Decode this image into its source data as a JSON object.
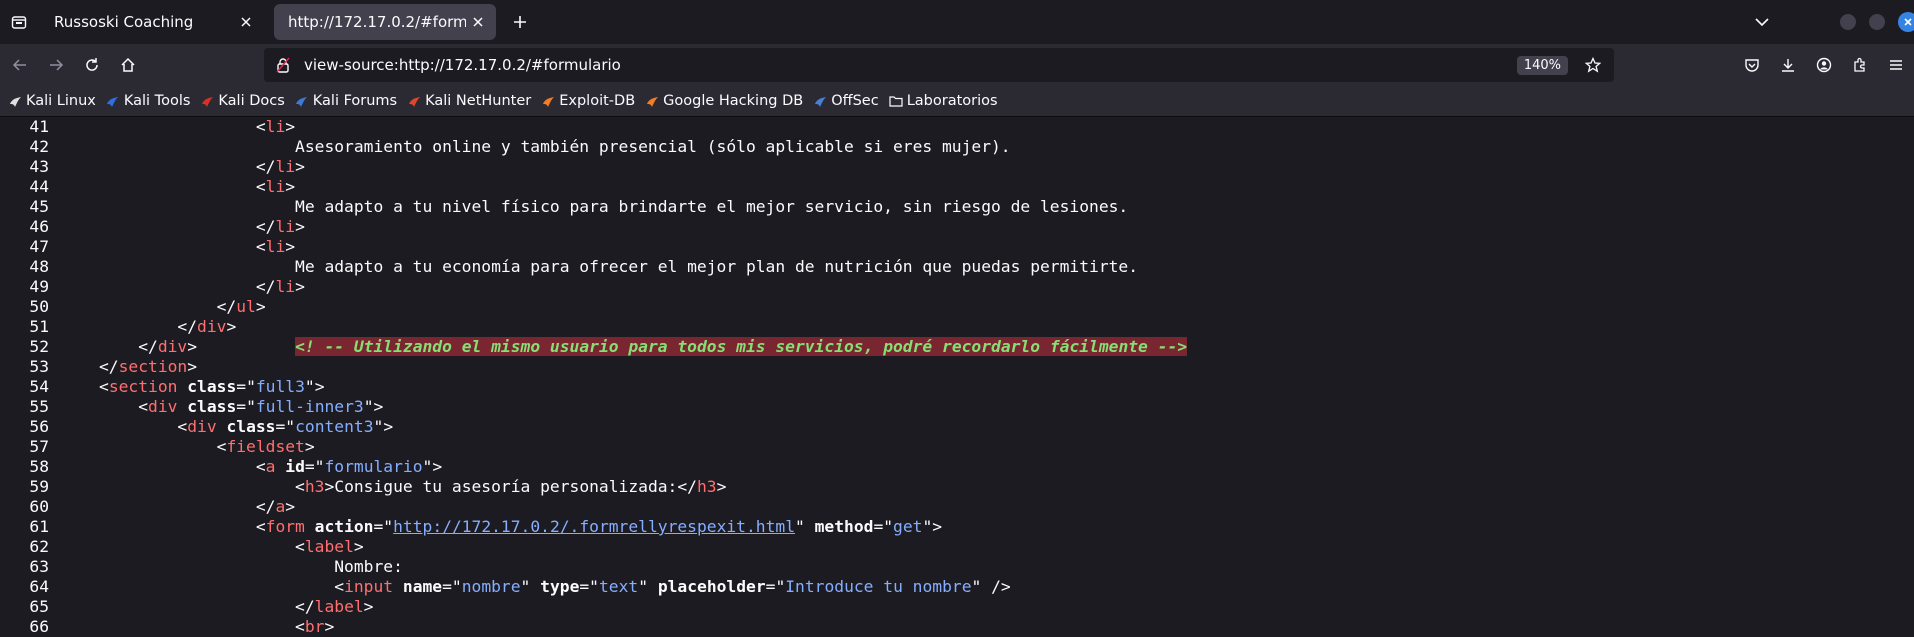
{
  "tabs": [
    {
      "title": "Russoski Coaching",
      "active": false
    },
    {
      "title": "http://172.17.0.2/#formulario",
      "active": true
    }
  ],
  "urlbar": {
    "url": "view-source:http://172.17.0.2/#formulario",
    "zoom": "140%"
  },
  "bookmarks": [
    {
      "label": "Kali Linux",
      "icon": "kali-dragon-icon",
      "color": "#e0e0e0"
    },
    {
      "label": "Kali Tools",
      "icon": "kali-tools-icon",
      "color": "#2f6fe0"
    },
    {
      "label": "Kali Docs",
      "icon": "kali-docs-icon",
      "color": "#d93025"
    },
    {
      "label": "Kali Forums",
      "icon": "kali-forums-icon",
      "color": "#3a7bd5"
    },
    {
      "label": "Kali NetHunter",
      "icon": "kali-nethunter-icon",
      "color": "#e0452d"
    },
    {
      "label": "Exploit-DB",
      "icon": "exploit-db-icon",
      "color": "#f07d2a"
    },
    {
      "label": "Google Hacking DB",
      "icon": "ghdb-icon",
      "color": "#f07d2a"
    },
    {
      "label": "OffSec",
      "icon": "offsec-icon",
      "color": "#4a7fd8"
    },
    {
      "label": "Laboratorios",
      "icon": "folder-icon",
      "color": "#fbfbfe"
    }
  ],
  "colors": {
    "tag": "#ff6f6f",
    "value": "#86aeff",
    "comment": "#86de74",
    "comment_bg": "#7a2630"
  },
  "source_lines": [
    {
      "n": "41",
      "parts": [
        [
          "t",
          "                <"
        ],
        [
          "n",
          "li"
        ],
        [
          "t",
          ">"
        ]
      ]
    },
    {
      "n": "42",
      "parts": [
        [
          "t",
          "                    Asesoramiento online y también presencial (sólo aplicable si eres mujer)."
        ]
      ]
    },
    {
      "n": "43",
      "parts": [
        [
          "t",
          "                </"
        ],
        [
          "n",
          "li"
        ],
        [
          "t",
          ">"
        ]
      ]
    },
    {
      "n": "44",
      "parts": [
        [
          "t",
          "                <"
        ],
        [
          "n",
          "li"
        ],
        [
          "t",
          ">"
        ]
      ]
    },
    {
      "n": "45",
      "parts": [
        [
          "t",
          "                    Me adapto a tu nivel físico para brindarte el mejor servicio, sin riesgo de lesiones."
        ]
      ]
    },
    {
      "n": "46",
      "parts": [
        [
          "t",
          "                </"
        ],
        [
          "n",
          "li"
        ],
        [
          "t",
          ">"
        ]
      ]
    },
    {
      "n": "47",
      "parts": [
        [
          "t",
          "                <"
        ],
        [
          "n",
          "li"
        ],
        [
          "t",
          ">"
        ]
      ]
    },
    {
      "n": "48",
      "parts": [
        [
          "t",
          "                    Me adapto a tu economía para ofrecer el mejor plan de nutrición que puedas permitirte."
        ]
      ]
    },
    {
      "n": "49",
      "parts": [
        [
          "t",
          "                </"
        ],
        [
          "n",
          "li"
        ],
        [
          "t",
          ">"
        ]
      ]
    },
    {
      "n": "50",
      "parts": [
        [
          "t",
          "            </"
        ],
        [
          "n",
          "ul"
        ],
        [
          "t",
          ">"
        ]
      ]
    },
    {
      "n": "51",
      "parts": [
        [
          "t",
          "        </"
        ],
        [
          "n",
          "div"
        ],
        [
          "t",
          ">"
        ]
      ]
    },
    {
      "n": "52",
      "parts": [
        [
          "t",
          "    </"
        ],
        [
          "n",
          "div"
        ],
        [
          "t",
          ">          "
        ],
        [
          "c",
          "<! -- Utilizando el mismo usuario para todos mis servicios, podré recordarlo fácilmente -->"
        ]
      ]
    },
    {
      "n": "53",
      "parts": [
        [
          "t",
          "</"
        ],
        [
          "n",
          "section"
        ],
        [
          "t",
          ">"
        ]
      ]
    },
    {
      "n": "54",
      "parts": [
        [
          "t",
          "<"
        ],
        [
          "n",
          "section"
        ],
        [
          "t",
          " "
        ],
        [
          "a",
          "class"
        ],
        [
          "t",
          "=\""
        ],
        [
          "v",
          "full3"
        ],
        [
          "t",
          "\">"
        ]
      ]
    },
    {
      "n": "55",
      "parts": [
        [
          "t",
          "    <"
        ],
        [
          "n",
          "div"
        ],
        [
          "t",
          " "
        ],
        [
          "a",
          "class"
        ],
        [
          "t",
          "=\""
        ],
        [
          "v",
          "full-inner3"
        ],
        [
          "t",
          "\">"
        ]
      ]
    },
    {
      "n": "56",
      "parts": [
        [
          "t",
          "        <"
        ],
        [
          "n",
          "div"
        ],
        [
          "t",
          " "
        ],
        [
          "a",
          "class"
        ],
        [
          "t",
          "=\""
        ],
        [
          "v",
          "content3"
        ],
        [
          "t",
          "\">"
        ]
      ]
    },
    {
      "n": "57",
      "parts": [
        [
          "t",
          "            <"
        ],
        [
          "n",
          "fieldset"
        ],
        [
          "t",
          ">"
        ]
      ]
    },
    {
      "n": "58",
      "parts": [
        [
          "t",
          "                <"
        ],
        [
          "n",
          "a"
        ],
        [
          "t",
          " "
        ],
        [
          "a",
          "id"
        ],
        [
          "t",
          "=\""
        ],
        [
          "v",
          "formulario"
        ],
        [
          "t",
          "\">"
        ]
      ]
    },
    {
      "n": "59",
      "parts": [
        [
          "t",
          "                    <"
        ],
        [
          "n",
          "h3"
        ],
        [
          "t",
          ">Consigue tu asesoría personalizada:</"
        ],
        [
          "n",
          "h3"
        ],
        [
          "t",
          ">"
        ]
      ]
    },
    {
      "n": "60",
      "parts": [
        [
          "t",
          "                </"
        ],
        [
          "n",
          "a"
        ],
        [
          "t",
          ">"
        ]
      ]
    },
    {
      "n": "61",
      "parts": [
        [
          "t",
          "                <"
        ],
        [
          "n",
          "form"
        ],
        [
          "t",
          " "
        ],
        [
          "a",
          "action"
        ],
        [
          "t",
          "=\""
        ],
        [
          "l",
          "http://172.17.0.2/.formrellyrespexit.html"
        ],
        [
          "t",
          "\" "
        ],
        [
          "a",
          "method"
        ],
        [
          "t",
          "=\""
        ],
        [
          "v",
          "get"
        ],
        [
          "t",
          "\">"
        ]
      ]
    },
    {
      "n": "62",
      "parts": [
        [
          "t",
          "                    <"
        ],
        [
          "n",
          "label"
        ],
        [
          "t",
          ">"
        ]
      ]
    },
    {
      "n": "63",
      "parts": [
        [
          "t",
          "                        Nombre:"
        ]
      ]
    },
    {
      "n": "64",
      "parts": [
        [
          "t",
          "                        <"
        ],
        [
          "n",
          "input"
        ],
        [
          "t",
          " "
        ],
        [
          "a",
          "name"
        ],
        [
          "t",
          "=\""
        ],
        [
          "v",
          "nombre"
        ],
        [
          "t",
          "\" "
        ],
        [
          "a",
          "type"
        ],
        [
          "t",
          "=\""
        ],
        [
          "v",
          "text"
        ],
        [
          "t",
          "\" "
        ],
        [
          "a",
          "placeholder"
        ],
        [
          "t",
          "=\""
        ],
        [
          "v",
          "Introduce tu nombre"
        ],
        [
          "t",
          "\" />"
        ]
      ]
    },
    {
      "n": "65",
      "parts": [
        [
          "t",
          "                    </"
        ],
        [
          "n",
          "label"
        ],
        [
          "t",
          ">"
        ]
      ]
    },
    {
      "n": "66",
      "parts": [
        [
          "t",
          "                    <"
        ],
        [
          "n",
          "br"
        ],
        [
          "t",
          ">"
        ]
      ]
    }
  ]
}
